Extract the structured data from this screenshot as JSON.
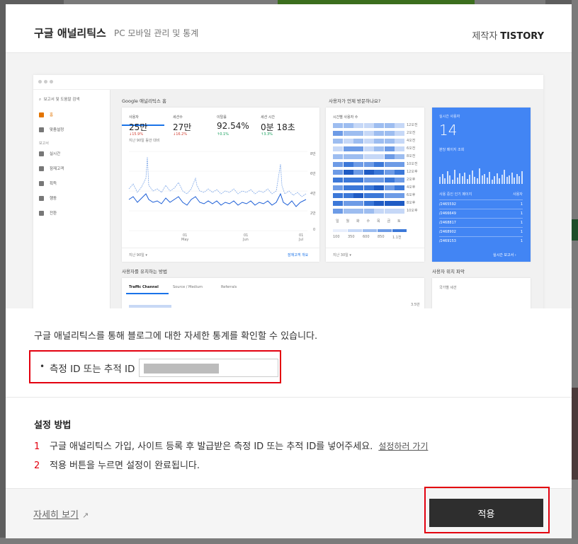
{
  "modal": {
    "title": "구글 애널리틱스",
    "subtitle": "PC 모바일 관리 및 통계",
    "maker_label": "제작자",
    "maker_name": "TISTORY"
  },
  "preview": {
    "search": "보고서 및 도움말 검색",
    "sidebar": [
      {
        "label": "홈",
        "icon": "home-icon",
        "active": true
      },
      {
        "label": "맞춤설정",
        "icon": "grid-icon",
        "active": false
      },
      {
        "label": "실시간",
        "icon": "clock-icon",
        "active": false
      },
      {
        "label": "잠재고객",
        "icon": "person-icon",
        "active": false
      },
      {
        "label": "획득",
        "icon": "acquisition-icon",
        "active": false
      },
      {
        "label": "행동",
        "icon": "behavior-icon",
        "active": false
      },
      {
        "label": "전환",
        "icon": "flag-icon",
        "active": false
      }
    ],
    "reports_section": "보고서",
    "home_title": "Google 애널리틱스 홈",
    "visit_title": "사용자가 언제 방문하나요?",
    "metrics": [
      {
        "label": "사용자",
        "value": "25만",
        "delta": "↓15.9%",
        "dir": "down"
      },
      {
        "label": "세션수",
        "value": "27만",
        "delta": "↓16.2%",
        "dir": "down"
      },
      {
        "label": "이탈률",
        "value": "92.54%",
        "delta": "↑0.1%",
        "dir": "up"
      },
      {
        "label": "세션 시간",
        "value": "0분 18초",
        "delta": "↑3.3%",
        "dir": "up"
      }
    ],
    "compare_note": "지난 90일 동안 대비",
    "y_ticks": [
      "8만",
      "6만",
      "4만",
      "2만",
      "0"
    ],
    "x_ticks": [
      {
        "d": "01",
        "m": "May"
      },
      {
        "d": "01",
        "m": "Jun"
      },
      {
        "d": "01",
        "m": "Jul"
      }
    ],
    "range_main": "지난 90일 ▾",
    "overview_link": "잠재고객 개요",
    "heat_title": "시간별 사용자 수",
    "heat_hours": [
      "12오전",
      "2오전",
      "4오전",
      "6오전",
      "8오전",
      "10오전",
      "12오후",
      "2오후",
      "4오후",
      "6오후",
      "8오후",
      "10오후"
    ],
    "heat_days": [
      "일",
      "월",
      "화",
      "수",
      "목",
      "금",
      "토"
    ],
    "heat_scale": [
      "100",
      "350",
      "600",
      "850",
      "1.1천"
    ],
    "range_heat": "지난 30일 ▾",
    "rt": {
      "title": "실시간 사용자",
      "value": "14",
      "pv_label": "분당 페이지 조회",
      "col1": "사용 중인 인기 페이지",
      "col2": "사용자",
      "rows": [
        {
          "page": "/2465592",
          "users": "1"
        },
        {
          "page": "/2466649",
          "users": "1"
        },
        {
          "page": "/2468817",
          "users": "1"
        },
        {
          "page": "/2468902",
          "users": "1"
        },
        {
          "page": "/2469153",
          "users": "1"
        }
      ],
      "report_link": "실시간 보고서"
    },
    "acquire_title": "사용자를 유치하는 방법",
    "acquire_tabs": [
      "Traffic Channel",
      "Source / Medium",
      "Referrals"
    ],
    "acquire_tick": "3.5만",
    "location_title": "사용자 위치 파악",
    "country_session": "국가별 세션"
  },
  "description": "구글 애널리틱스를 통해 블로그에 대한 자세한 통계를 확인할 수 있습니다.",
  "id_field": {
    "label": "측정 ID 또는 추적 ID",
    "value": "",
    "placeholder": ""
  },
  "setup": {
    "title": "설정 방법",
    "steps": [
      {
        "num": "1",
        "text": "구글 애널리틱스 가입, 사이트 등록 후 발급받은 측정 ID 또는 추적 ID를 넣어주세요.",
        "link": "설정하러 가기"
      },
      {
        "num": "2",
        "text": "적용 버튼을 누르면 설정이 완료됩니다.",
        "link": ""
      }
    ]
  },
  "footer": {
    "more_label": "자세히 보기",
    "apply_label": "적용"
  },
  "colors": {
    "accent_red": "#e3000f",
    "apply_bg": "#2e2e2e",
    "ga_blue": "#4285f4"
  }
}
